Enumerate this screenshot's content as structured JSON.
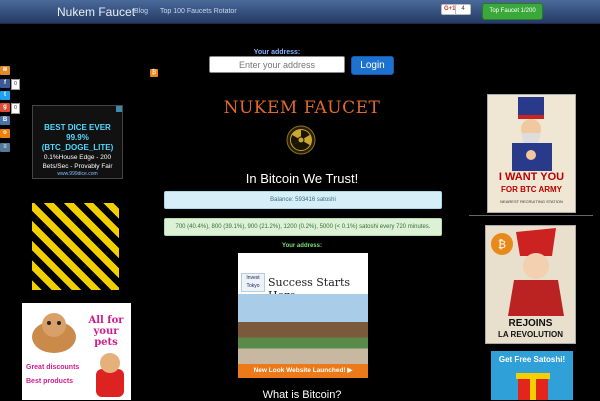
{
  "navbar": {
    "brand": "Nukem Faucet",
    "links": [
      "Blog",
      "Top 100 Faucets Rotator"
    ],
    "gplus_label": "G+1",
    "gplus_count": "4",
    "top_button": "Top Faucet 1/200"
  },
  "address_form": {
    "label": "Your address:",
    "placeholder": "Enter your address",
    "login_button": "Login"
  },
  "share": {
    "counts": [
      "0",
      "0"
    ]
  },
  "left_ads": {
    "dice": {
      "headline": "BEST DICE EVER 99.9% (BTC_DOGE_LITE)",
      "body": "0.1%House Edge - 200 Bets/Sec - Provably Fair",
      "url": "www.999dice.com"
    },
    "pets": {
      "tagline": "All for your pets",
      "line1": "Great discounts",
      "line2": "Best products"
    }
  },
  "main": {
    "site_title": "NUKEM FAUCET",
    "slogan": "In Bitcoin We Trust!",
    "balance": "Balance: 593416 satoshi",
    "rewards": "700 (40.4%), 800 (39.1%), 900 (21.2%), 1200 (0.2%), 5000 (< 0.1%) satoshi every 720 minutes.",
    "address_label": "Your address:",
    "what_is": "What is Bitcoin?"
  },
  "tokyo_ad": {
    "logo": "Invest Tokyo",
    "headline": "Success Starts Here",
    "footer": "New Look Website Launched! ▶"
  },
  "right_ads": {
    "poster1": {
      "line1": "I WANT YOU",
      "line2": "FOR BTC ARMY",
      "line3": "NEAREST RECRUITING STATION"
    },
    "poster2": {
      "line1": "REJOINS",
      "line2": "LA REVOLUTION"
    },
    "freesat": "Get Free Satoshi!"
  },
  "colors": {
    "navbar": "#243a63",
    "title_orange": "#e06a2a",
    "login_blue": "#1e72cf",
    "top_green": "#3aa83a"
  }
}
